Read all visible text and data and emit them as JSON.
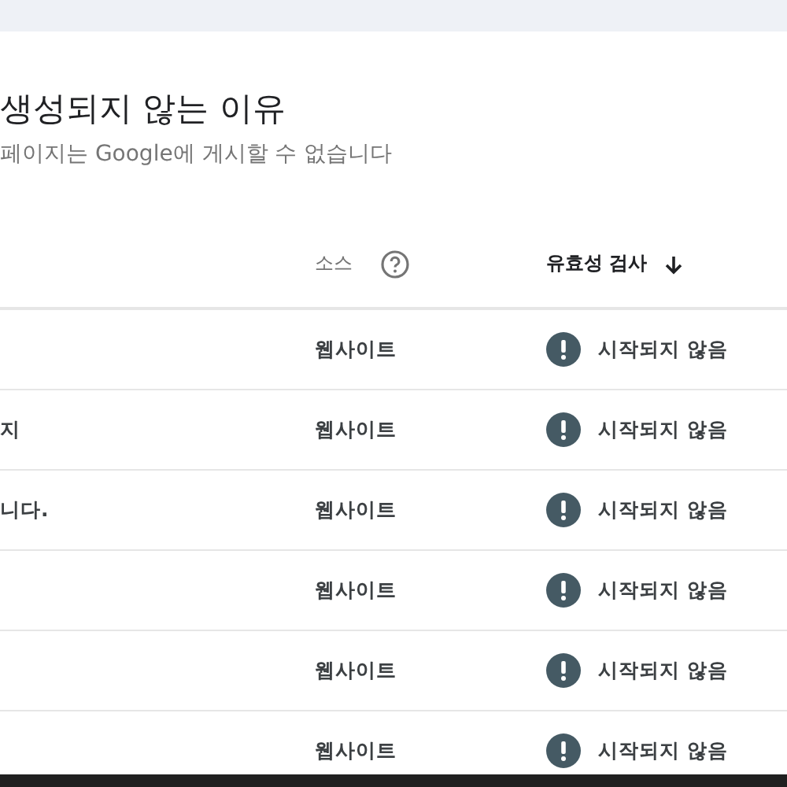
{
  "title": "생성되지 않는 이유",
  "subtitle": "페이지는 Google에 게시할 수 없습니다",
  "table": {
    "columns": [
      {
        "label": "소스",
        "help": true,
        "sorted_descending": false
      },
      {
        "label": "유효성 검사",
        "help": false,
        "sorted_descending": true
      }
    ],
    "rows": [
      {
        "source": "웹사이트",
        "validation": "시작되지 않음"
      },
      {
        "column_1": "지",
        "source": "웹사이트",
        "validation": "시작되지 않음"
      },
      {
        "column_1": "니다.",
        "source": "웹사이트",
        "validation": "시작되지 않음"
      },
      {
        "source": "웹사이트",
        "validation": "시작되지 않음"
      },
      {
        "source": "웹사이트",
        "validation": "시작되지 않음"
      },
      {
        "source": "웹사이트",
        "validation": "시작되지 않음"
      }
    ]
  }
}
